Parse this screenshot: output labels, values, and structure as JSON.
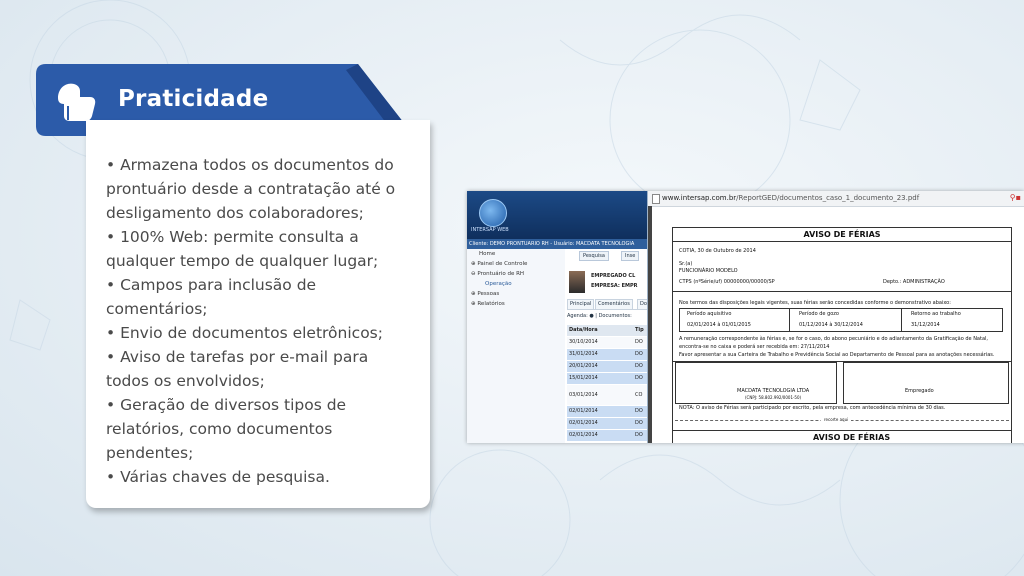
{
  "header": {
    "title": "Praticidade",
    "icon": "thumbs-up-icon"
  },
  "colors": {
    "ribbon": "#2c5ba9",
    "ribbon_dark": "#1e4386",
    "text": "#4a4a4a"
  },
  "bullets": [
    "• Armazena todos os documentos do prontuário desde a contratação até o desligamento dos colaboradores;",
    "• 100% Web: permite consulta a qualquer tempo de qualquer lugar;",
    "• Campos para inclusão de comentários;",
    "• Envio de documentos eletrônicos;",
    "• Aviso de tarefas por e-mail para todos os envolvidos;",
    "• Geração de diversos tipos de relatórios, como documentos pendentes;",
    "• Várias chaves de pesquisa."
  ],
  "app": {
    "logo_text": "INTERSAP WEB",
    "client_bar": "Cliente: DEMO PRONTUARIO RH - Usuário: MACDATA TECNOLOGIA",
    "nav": [
      "Home",
      "Painel de Controle",
      "Prontuário de RH",
      "Operação",
      "Pessoas",
      "Relatórios"
    ],
    "top_tabs": [
      "Pesquisa",
      "Inse"
    ],
    "employee_line1": "EMPREGADO CL",
    "employee_line2": "EMPRESA: EMPR",
    "sub_tabs": [
      "Principal",
      "Comentários",
      "Do"
    ],
    "agenda": "Agenda: ● | Documentos:",
    "table_headers": [
      "Data/Hora",
      "Tip"
    ],
    "table_rows": [
      [
        "30/10/2014",
        "DO"
      ],
      [
        "31/01/2014",
        "DO"
      ],
      [
        "20/01/2014",
        "DO"
      ],
      [
        "15/01/2014",
        "DO"
      ],
      [
        "03/01/2014",
        "CO"
      ],
      [
        "02/01/2014",
        "DO"
      ],
      [
        "02/01/2014",
        "DO"
      ],
      [
        "02/01/2014",
        "DO"
      ]
    ]
  },
  "pdf": {
    "url_domain": "www.intersap.com.br",
    "url_path": "/ReportGED/documentos_caso_1_documento_23.pdf",
    "title": "AVISO DE FÉRIAS",
    "date_line": "COTIA, 30 de Outubro de 2014",
    "sr": "Sr.(a)",
    "employee": "FUNCIONÁRIO MODELO",
    "ctps": "CTPS (nºSérie/uf)   00000000/00000/SP",
    "depto": "Depto.: ADMINISTRAÇÃO",
    "notice": "Nos termos das disposições legais vigentes, suas férias serão concedidas conforme o demonstrativo abaixo:",
    "col1": "Período aquisitivo",
    "col2": "Período de gozo",
    "col3": "Retorno ao trabalho",
    "val1": "02/01/2014    à    01/01/2015",
    "val2": "01/12/2014    à    30/12/2014",
    "val3": "31/12/2014",
    "para1": "A remuneração correspondente às férias e, se for o caso, do abono pecuniário e do adiantamento da Gratificação de Natal,",
    "para2": "encontra-se no caixa e poderá ser recebida em: 27/11/2014",
    "para3": "Favor apresentar a sua Carteira de Trabalho e Previdência Social ao Departamento de Pessoal para as anotações necessárias.",
    "company": "MACDATA TECNOLOGIA LTDA",
    "cnpj": "(CNPJ: 58.802.992/0001-50)",
    "empregado": "Empregado",
    "nota": "NOTA: O aviso de Férias será participado por escrito, pela empresa, com antecedência mínima de 30 dias.",
    "recorte": "recorte aqui",
    "title2": "AVISO DE FÉRIAS"
  }
}
